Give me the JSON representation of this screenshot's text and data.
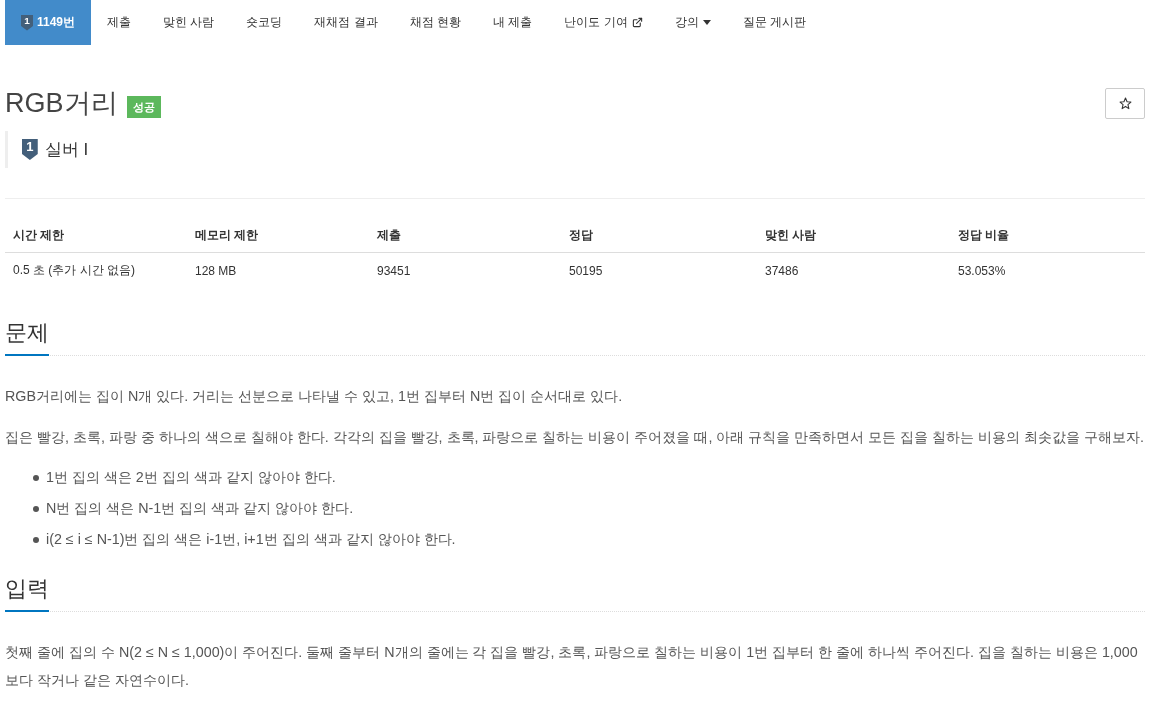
{
  "nav": {
    "tabs": [
      {
        "kind": "problem",
        "badge": "1",
        "label": "1149번",
        "selected": true
      },
      {
        "kind": "plain",
        "label": "제출",
        "selected": false
      },
      {
        "kind": "plain",
        "label": "맞힌 사람",
        "selected": false
      },
      {
        "kind": "plain",
        "label": "숏코딩",
        "selected": false
      },
      {
        "kind": "plain",
        "label": "재채점 결과",
        "selected": false
      },
      {
        "kind": "plain",
        "label": "채점 현황",
        "selected": false
      },
      {
        "kind": "plain",
        "label": "내 제출",
        "selected": false
      },
      {
        "kind": "external",
        "label": "난이도 기여",
        "selected": false
      },
      {
        "kind": "dropdown",
        "label": "강의",
        "selected": false
      },
      {
        "kind": "plain",
        "label": "질문 게시판",
        "selected": false
      }
    ]
  },
  "title": {
    "text": "RGB거리",
    "result": "성공",
    "starred": false
  },
  "tier": {
    "badge": "1",
    "label": "실버 I"
  },
  "stats": {
    "columns": [
      "시간 제한",
      "메모리 제한",
      "제출",
      "정답",
      "맞힌 사람",
      "정답 비율"
    ],
    "rows": [
      [
        "0.5 초 (추가 시간 없음)",
        "128 MB",
        "93451",
        "50195",
        "37486",
        "53.053%"
      ]
    ]
  },
  "sections": [
    {
      "heading": "문제",
      "paragraphs": [
        "RGB거리에는 집이 N개 있다. 거리는 선분으로 나타낼 수 있고, 1번 집부터 N번 집이 순서대로 있다.",
        "집은 빨강, 초록, 파랑 중 하나의 색으로 칠해야 한다. 각각의 집을 빨강, 초록, 파랑으로 칠하는 비용이 주어졌을 때, 아래 규칙을 만족하면서 모든 집을 칠하는 비용의 최솟값을 구해보자."
      ],
      "bullets": [
        "1번 집의 색은 2번 집의 색과 같지 않아야 한다.",
        "N번 집의 색은 N-1번 집의 색과 같지 않아야 한다.",
        "i(2 ≤ i ≤ N-1)번 집의 색은 i-1번, i+1번 집의 색과 같지 않아야 한다."
      ]
    },
    {
      "heading": "입력",
      "paragraphs": [
        "첫째 줄에 집의 수 N(2 ≤ N ≤ 1,000)이 주어진다. 둘째 줄부터 N개의 줄에는 각 집을 빨강, 초록, 파랑으로 칠하는 비용이 1번 집부터 한 줄에 하나씩 주어진다. 집을 칠하는 비용은 1,000보다 작거나 같은 자연수이다."
      ]
    }
  ]
}
